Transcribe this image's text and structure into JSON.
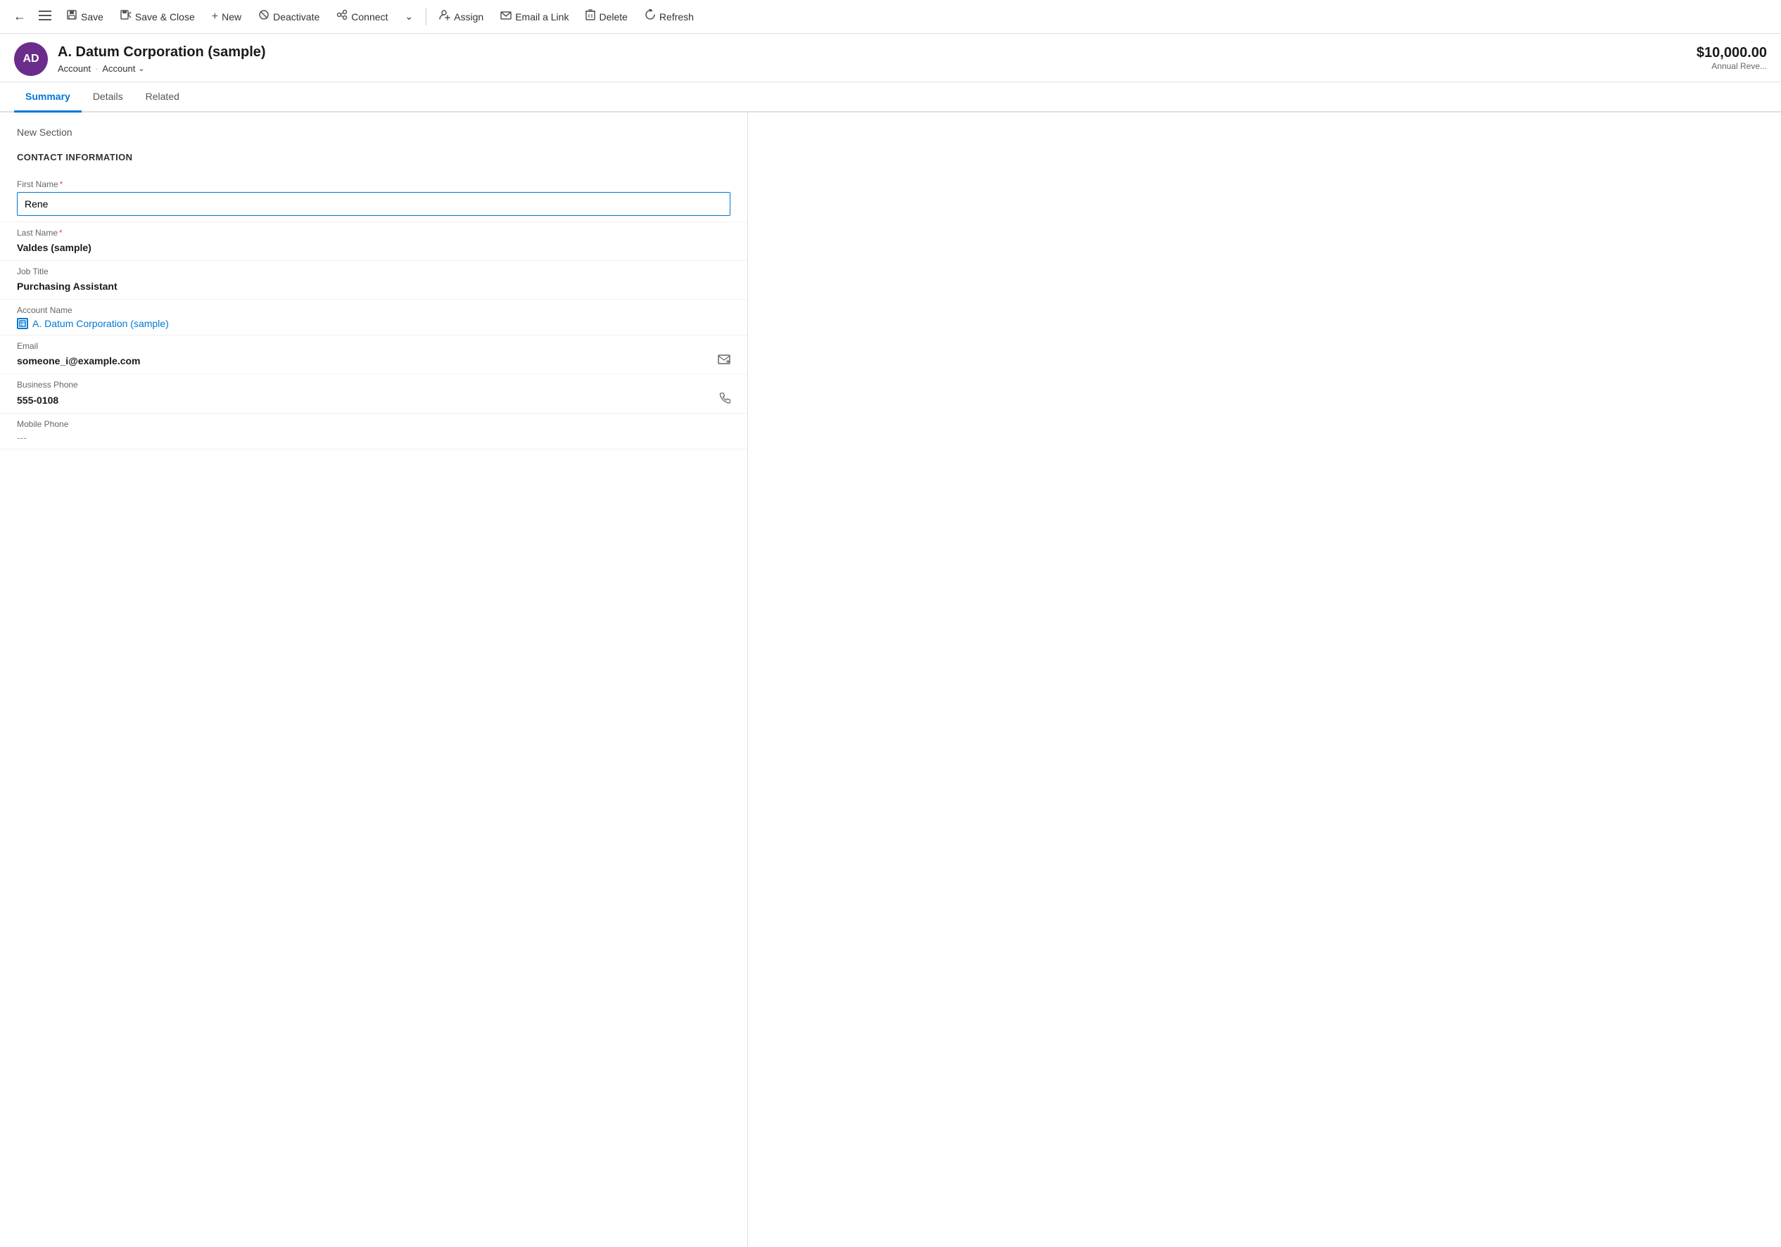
{
  "toolbar": {
    "back_label": "←",
    "menu_label": "☰",
    "save_label": "Save",
    "save_close_label": "Save & Close",
    "new_label": "New",
    "deactivate_label": "Deactivate",
    "connect_label": "Connect",
    "more_label": "⌄",
    "assign_label": "Assign",
    "email_link_label": "Email a Link",
    "delete_label": "Delete",
    "refresh_label": "Refresh"
  },
  "record": {
    "avatar_initials": "AD",
    "title": "A. Datum Corporation (sample)",
    "breadcrumb_type": "Account",
    "breadcrumb_entity": "Account",
    "revenue_value": "$10,000.00",
    "revenue_label": "Annual Reve..."
  },
  "tabs": [
    {
      "id": "summary",
      "label": "Summary",
      "active": true
    },
    {
      "id": "details",
      "label": "Details",
      "active": false
    },
    {
      "id": "related",
      "label": "Related",
      "active": false
    }
  ],
  "form": {
    "section_new": "New Section",
    "section_contact": "CONTACT INFORMATION",
    "fields": [
      {
        "id": "first_name",
        "label": "First Name",
        "required": true,
        "type": "input",
        "value": "Rene"
      },
      {
        "id": "last_name",
        "label": "Last Name",
        "required": true,
        "type": "text",
        "value": "Valdes (sample)"
      },
      {
        "id": "job_title",
        "label": "Job Title",
        "required": false,
        "type": "text",
        "value": "Purchasing Assistant"
      },
      {
        "id": "account_name",
        "label": "Account Name",
        "required": false,
        "type": "link",
        "value": "A. Datum Corporation (sample)"
      },
      {
        "id": "email",
        "label": "Email",
        "required": false,
        "type": "text_action",
        "value": "someone_i@example.com",
        "action_icon": "email"
      },
      {
        "id": "business_phone",
        "label": "Business Phone",
        "required": false,
        "type": "text_action",
        "value": "555-0108",
        "action_icon": "phone"
      },
      {
        "id": "mobile_phone",
        "label": "Mobile Phone",
        "required": false,
        "type": "dashes",
        "value": "---"
      }
    ]
  }
}
